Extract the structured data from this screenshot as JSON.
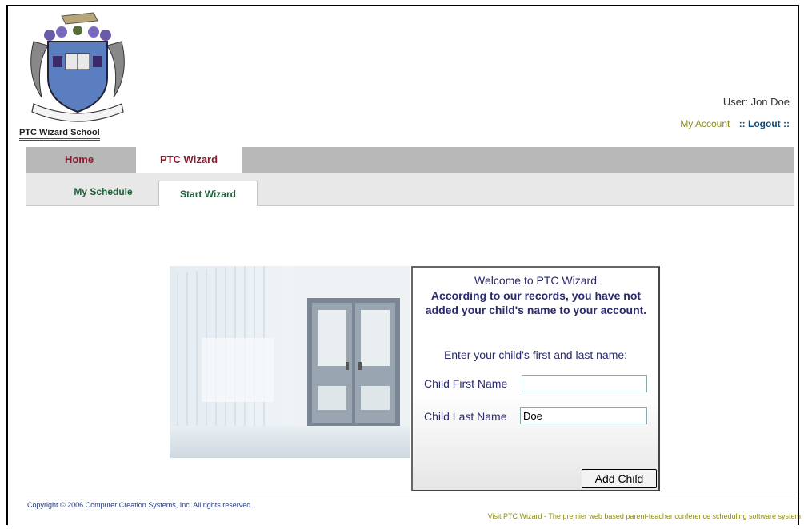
{
  "header": {
    "school_name": "PTC Wizard School",
    "user_label": "User: Jon Doe",
    "my_account": "My Account",
    "logout": ":: Logout ::"
  },
  "nav": {
    "tabs": [
      {
        "label": "Home",
        "active": false
      },
      {
        "label": "PTC Wizard",
        "active": true
      }
    ],
    "subtabs": [
      {
        "label": "My Schedule",
        "active": false
      },
      {
        "label": "Start Wizard",
        "active": true
      }
    ]
  },
  "wizard": {
    "welcome": "Welcome to PTC Wizard",
    "notice": "According to our records, you have not added your child's name to your account.",
    "instruction": "Enter your child's first and last name:",
    "first_name_label": "Child First Name",
    "first_name_value": "",
    "last_name_label": "Child Last Name",
    "last_name_value": "Doe",
    "add_button": "Add Child"
  },
  "footer": {
    "copyright": "Copyright © 2006 Computer Creation Systems, Inc. All rights reserved.",
    "visit": "Visit PTC Wizard - The premier web based parent-teacher conference scheduling software system"
  },
  "colors": {
    "nav_tab_text": "#8b1a2e",
    "subtab_text": "#20603a",
    "panel_text": "#2a2a6e",
    "footer_link": "#8a8a1c"
  }
}
